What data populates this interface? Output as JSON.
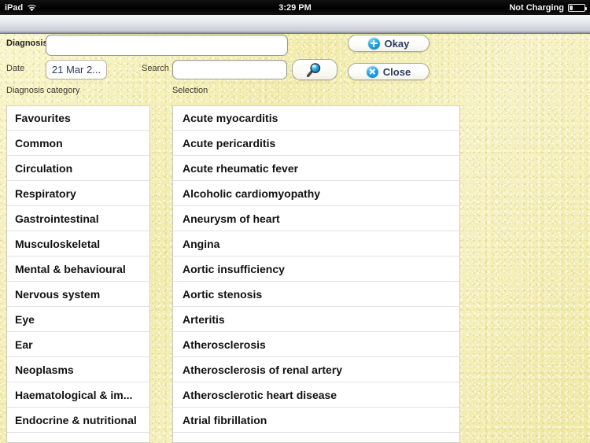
{
  "status_bar": {
    "device": "iPad",
    "wifi_icon": "wifi-icon",
    "time": "3:29 PM",
    "battery_text": "Not Charging",
    "battery_icon": "battery-icon"
  },
  "form": {
    "diagnosis_label": "Diagnosis",
    "diagnosis_value": "",
    "diagnosis_placeholder": "",
    "date_label": "Date",
    "date_value": "21 Mar 2...",
    "search_label": "Search",
    "search_value": "",
    "search_placeholder": "",
    "search_button_icon": "magnifier-icon",
    "okay_label": "Okay",
    "okay_icon": "plus-circle-icon",
    "close_label": "Close",
    "close_icon": "close-circle-icon"
  },
  "columns": {
    "category_header": "Diagnosis category",
    "selection_header": "Selection"
  },
  "category_list": [
    "Favourites",
    "Common",
    "Circulation",
    "Respiratory",
    "Gastrointestinal",
    "Musculoskeletal",
    "Mental & behavioural",
    "Nervous system",
    "Eye",
    "Ear",
    "Neoplasms",
    "Haematological & im...",
    "Endocrine & nutritional"
  ],
  "diagnosis_list": [
    "Acute myocarditis",
    "Acute pericarditis",
    "Acute rheumatic fever",
    "Alcoholic cardiomyopathy",
    "Aneurysm of heart",
    "Angina",
    "Aortic insufficiency",
    "Aortic stenosis",
    "Arteritis",
    "Atherosclerosis",
    "Atherosclerosis of renal artery",
    "Atherosclerotic heart disease",
    "Atrial fibrillation"
  ],
  "colors": {
    "background": "#f3eeb0",
    "accent_blue": "#1ba2e4",
    "button_text": "#2b3b63",
    "date_text": "#2c3e66",
    "status_bar": "#000000"
  }
}
